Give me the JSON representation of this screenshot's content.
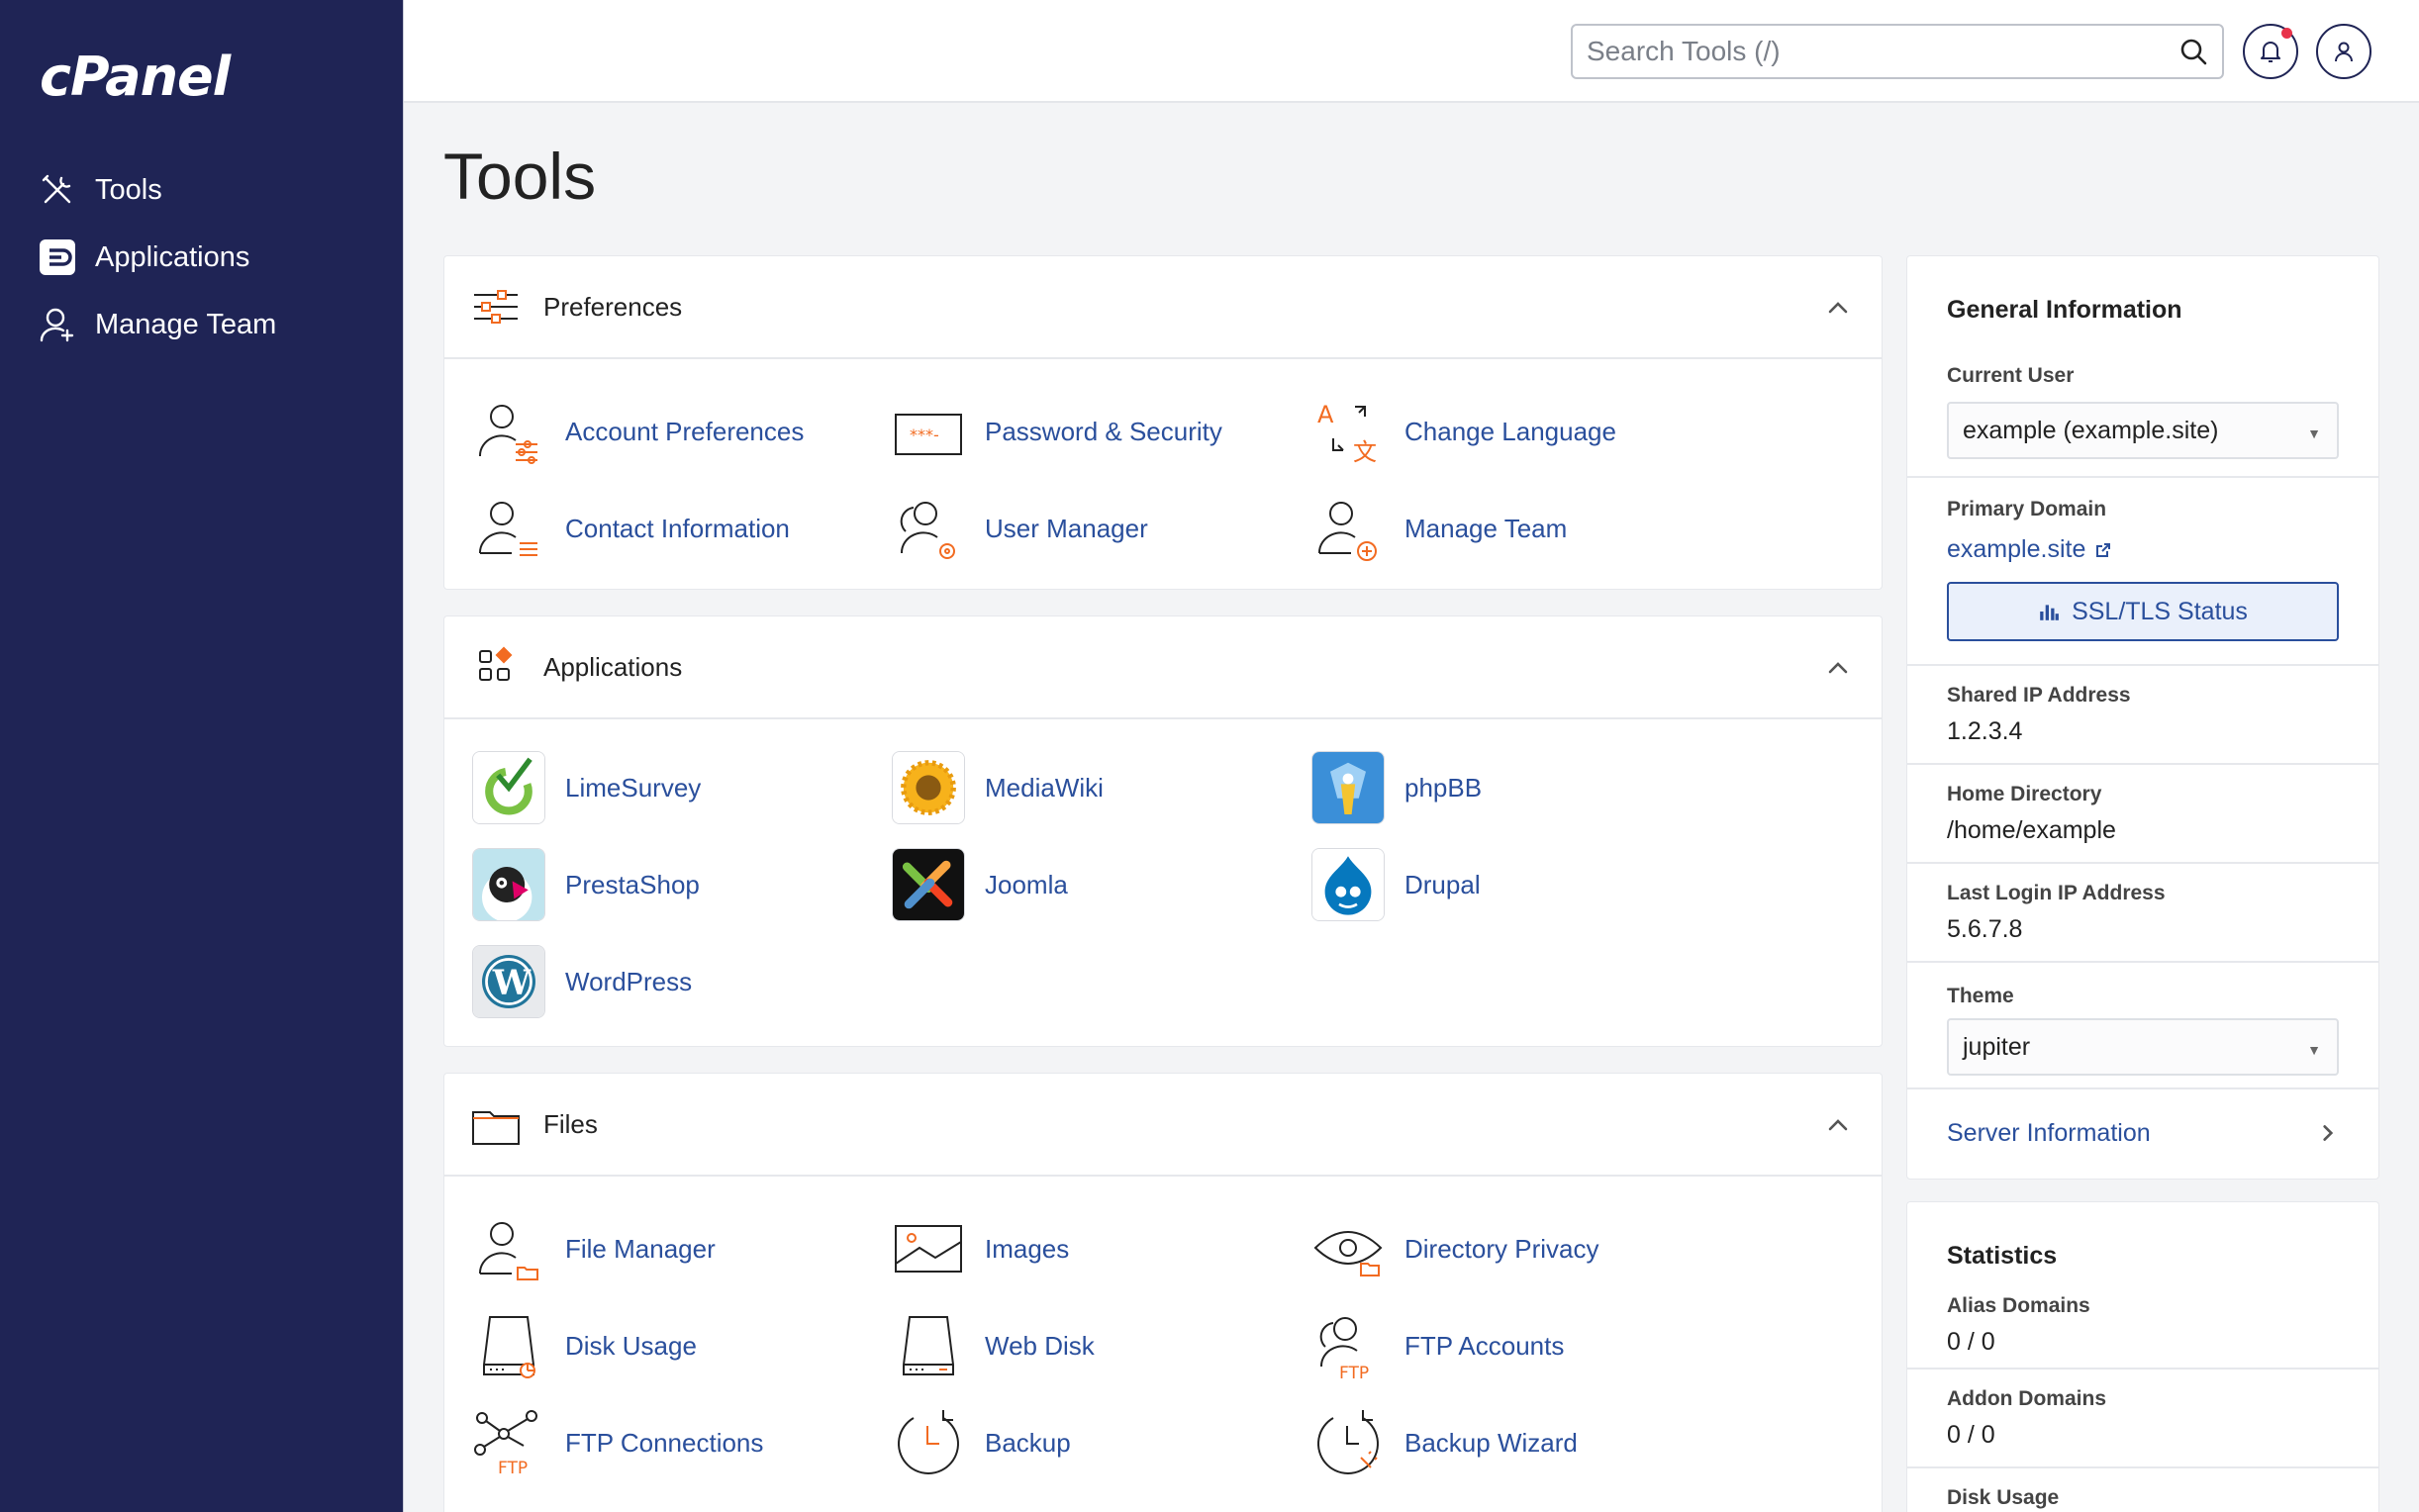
{
  "brand": {
    "logo_text": "cPanel"
  },
  "sidebar": {
    "items": [
      {
        "label": "Tools",
        "icon": "tools-icon"
      },
      {
        "label": "Applications",
        "icon": "applications-icon"
      },
      {
        "label": "Manage Team",
        "icon": "manage-team-icon"
      }
    ]
  },
  "header": {
    "search_placeholder": "Search Tools (/)",
    "search_value": ""
  },
  "page": {
    "title": "Tools"
  },
  "sections": {
    "preferences": {
      "title": "Preferences",
      "tools": [
        "Account Preferences",
        "Password & Security",
        "Change Language",
        "Contact Information",
        "User Manager",
        "Manage Team"
      ]
    },
    "applications": {
      "title": "Applications",
      "tools": [
        "LimeSurvey",
        "MediaWiki",
        "phpBB",
        "PrestaShop",
        "Joomla",
        "Drupal",
        "WordPress"
      ]
    },
    "files": {
      "title": "Files",
      "tools": [
        "File Manager",
        "Images",
        "Directory Privacy",
        "Disk Usage",
        "Web Disk",
        "FTP Accounts",
        "FTP Connections",
        "Backup",
        "Backup Wizard"
      ]
    }
  },
  "general_info": {
    "title": "General Information",
    "current_user_label": "Current User",
    "current_user_value": "example (example.site)",
    "primary_domain_label": "Primary Domain",
    "primary_domain_value": "example.site",
    "ssl_button": "SSL/TLS Status",
    "shared_ip_label": "Shared IP Address",
    "shared_ip_value": "1.2.3.4",
    "home_dir_label": "Home Directory",
    "home_dir_value": "/home/example",
    "last_login_label": "Last Login IP Address",
    "last_login_value": "5.6.7.8",
    "theme_label": "Theme",
    "theme_value": "jupiter",
    "server_info_link": "Server Information"
  },
  "statistics": {
    "title": "Statistics",
    "alias_label": "Alias Domains",
    "alias_value": "0 / 0",
    "addon_label": "Addon Domains",
    "addon_value": "0 / 0",
    "disk_label": "Disk Usage"
  },
  "colors": {
    "sidebar_bg": "#1f2455",
    "link": "#2a4f9c",
    "accent_orange": "#f26b21",
    "notification_dot": "#e8334a"
  }
}
